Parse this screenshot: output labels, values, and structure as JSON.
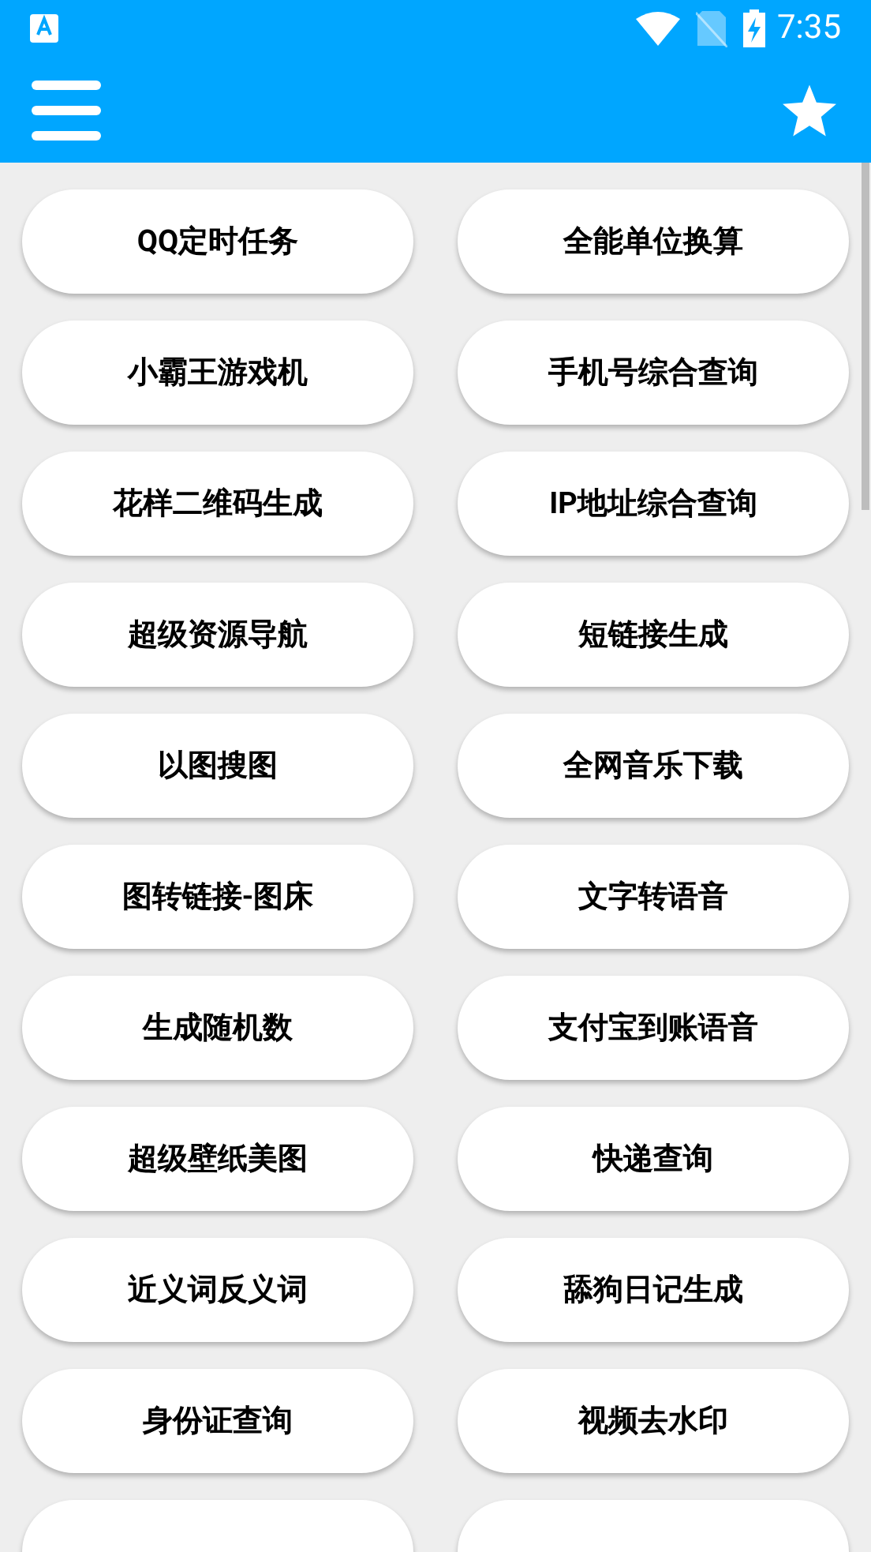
{
  "status_bar": {
    "time": "7:35"
  },
  "tools": [
    {
      "label": "QQ定时任务"
    },
    {
      "label": "全能单位换算"
    },
    {
      "label": "小霸王游戏机"
    },
    {
      "label": "手机号综合查询"
    },
    {
      "label": "花样二维码生成"
    },
    {
      "label": "IP地址综合查询"
    },
    {
      "label": "超级资源导航"
    },
    {
      "label": "短链接生成"
    },
    {
      "label": "以图搜图"
    },
    {
      "label": "全网音乐下载"
    },
    {
      "label": "图转链接-图床"
    },
    {
      "label": "文字转语音"
    },
    {
      "label": "生成随机数"
    },
    {
      "label": "支付宝到账语音"
    },
    {
      "label": "超级壁纸美图"
    },
    {
      "label": "快递查询"
    },
    {
      "label": "近义词反义词"
    },
    {
      "label": "舔狗日记生成"
    },
    {
      "label": "身份证查询"
    },
    {
      "label": "视频去水印"
    },
    {
      "kind": "cut-off"
    },
    {
      "kind": "cut-off"
    }
  ]
}
